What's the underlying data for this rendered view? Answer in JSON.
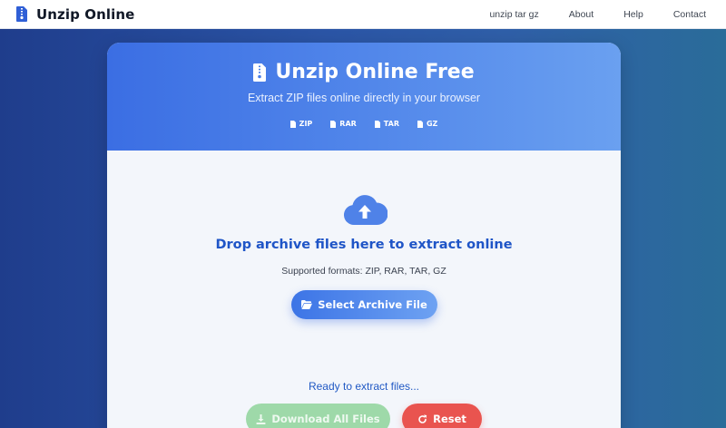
{
  "navbar": {
    "brand": "Unzip Online",
    "links": [
      "unzip tar gz",
      "About",
      "Help",
      "Contact"
    ]
  },
  "card": {
    "title": "Unzip Online Free",
    "subtitle": "Extract ZIP files online directly in your browser",
    "formats": [
      "ZIP",
      "RAR",
      "TAR",
      "GZ"
    ]
  },
  "dropzone": {
    "icon": "cloud-upload-icon",
    "heading": "Drop archive files here to extract online",
    "supported": "Supported formats: ZIP, RAR, TAR, GZ",
    "select_label": "Select Archive File"
  },
  "status": "Ready to extract files...",
  "actions": {
    "download_label": "Download All Files",
    "reset_label": "Reset"
  },
  "colors": {
    "accent": "#3b6ee3",
    "heading": "#1f55c7",
    "download": "#9ed9a9",
    "reset": "#e9544f"
  }
}
